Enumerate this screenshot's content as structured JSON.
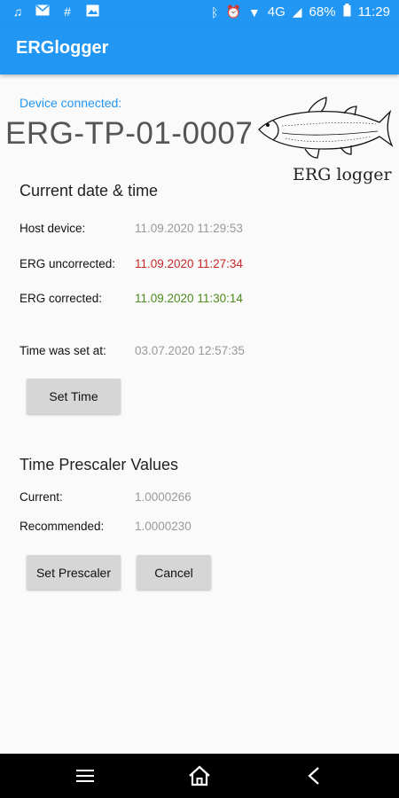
{
  "status_bar": {
    "battery": "68%",
    "network": "4G",
    "time": "11:29",
    "icons_left": [
      "music-note-icon",
      "mail-icon",
      "slack-icon",
      "image-icon"
    ],
    "icons_right": [
      "bluetooth-icon",
      "alarm-icon",
      "wifi-icon",
      "signal-icon",
      "battery-icon"
    ]
  },
  "app_bar": {
    "title": "ERGlogger"
  },
  "device": {
    "connected_label": "Device connected:",
    "id": "ERG-TP-01-0007"
  },
  "logo": {
    "text": "ERG logger"
  },
  "datetime": {
    "title": "Current date & time",
    "host_label": "Host device:",
    "host_value": "11.09.2020 11:29:53",
    "uncorrected_label": "ERG uncorrected:",
    "uncorrected_value": "11.09.2020 11:27:34",
    "corrected_label": "ERG corrected:",
    "corrected_value": "11.09.2020 11:30:14",
    "set_at_label": "Time was set at:",
    "set_at_value": "03.07.2020 12:57:35",
    "set_time_button": "Set Time"
  },
  "prescaler": {
    "title": "Time Prescaler Values",
    "current_label": "Current:",
    "current_value": "1.0000266",
    "recommended_label": "Recommended:",
    "recommended_value": "1.0000230",
    "set_button": "Set Prescaler",
    "cancel_button": "Cancel"
  },
  "colors": {
    "accent": "#2196f3",
    "uncorrected": "#c62828",
    "corrected": "#4c8c1c"
  },
  "nav_bar": [
    "menu-icon",
    "home-icon",
    "back-icon"
  ]
}
